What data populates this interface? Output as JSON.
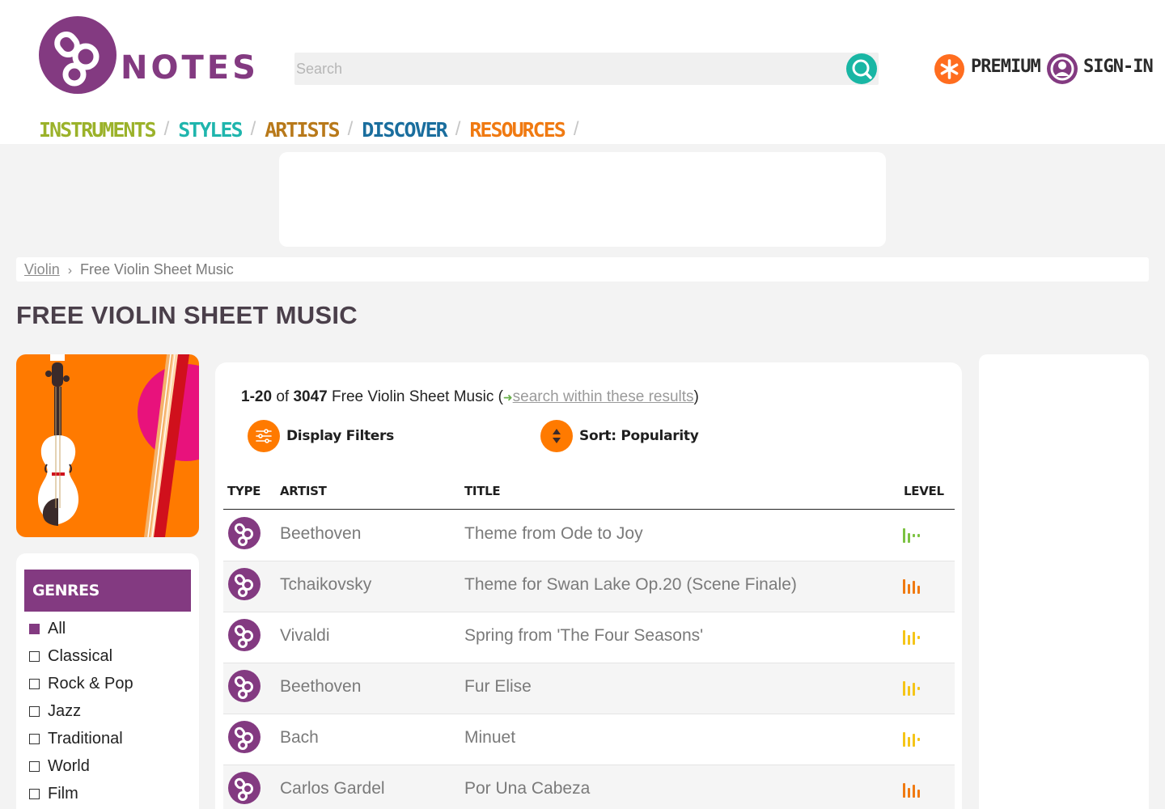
{
  "logo": {
    "word": "NOTES",
    "color": "#833a81"
  },
  "search": {
    "placeholder": "Search",
    "icon": "search-icon",
    "button_color": "#19b6a4"
  },
  "account": {
    "premium_label": "PREMIUM",
    "premium_icon": "asterisk-icon",
    "premium_color": "#ff6d1f",
    "signin_label": "SIGN-IN",
    "signin_icon": "user-icon",
    "signin_color": "#833a81"
  },
  "nav": [
    {
      "label": "INSTRUMENTS",
      "color": "#9bb22a"
    },
    {
      "label": "STYLES",
      "color": "#1fb5ad"
    },
    {
      "label": "ARTISTS",
      "color": "#b8791a"
    },
    {
      "label": "DISCOVER",
      "color": "#1a6e9e"
    },
    {
      "label": "RESOURCES",
      "color": "#f07a12"
    }
  ],
  "nav_separator": "/",
  "breadcrumb": {
    "parent": "Violin",
    "current": "Free Violin Sheet Music"
  },
  "page_title": "FREE VIOLIN SHEET MUSIC",
  "genres": {
    "heading": "GENRES",
    "items": [
      {
        "label": "All",
        "checked": true
      },
      {
        "label": "Classical",
        "checked": false
      },
      {
        "label": "Rock & Pop",
        "checked": false
      },
      {
        "label": "Jazz",
        "checked": false
      },
      {
        "label": "Traditional",
        "checked": false
      },
      {
        "label": "World",
        "checked": false
      },
      {
        "label": "Film",
        "checked": false
      }
    ]
  },
  "results": {
    "range": "1-20",
    "of": "of",
    "total": "3047",
    "description": "Free Violin Sheet Music (",
    "search_within": "search within these results",
    "close_paren": ")",
    "display_filters": "Display Filters",
    "sort": "Sort: Popularity",
    "columns": {
      "type": "TYPE",
      "artist": "ARTIST",
      "title": "TITLE",
      "level": "LEVEL"
    },
    "rows": [
      {
        "artist": "Beethoven",
        "title": "Theme from Ode to Joy",
        "level": 1,
        "level_color": "#7cc242"
      },
      {
        "artist": "Tchaikovsky",
        "title": "Theme for Swan Lake Op.20 (Scene Finale)",
        "level": 3,
        "level_color": "#f07a12"
      },
      {
        "artist": "Vivaldi",
        "title": "Spring from 'The Four Seasons'",
        "level": 2,
        "level_color": "#f5c518"
      },
      {
        "artist": "Beethoven",
        "title": "Fur Elise",
        "level": 2,
        "level_color": "#f5c518"
      },
      {
        "artist": "Bach",
        "title": "Minuet",
        "level": 2,
        "level_color": "#f5c518"
      },
      {
        "artist": "Carlos Gardel",
        "title": "Por Una Cabeza",
        "level": 3,
        "level_color": "#f07a12"
      }
    ]
  }
}
